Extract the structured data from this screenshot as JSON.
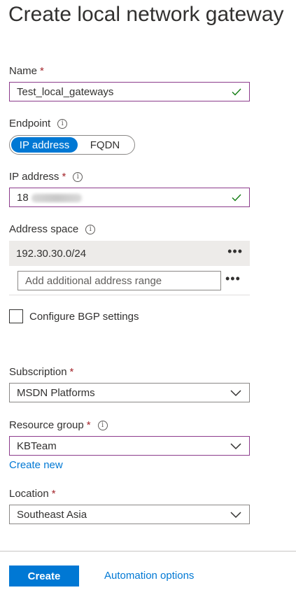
{
  "page": {
    "title": "Create local network gateway"
  },
  "name": {
    "label": "Name",
    "required_mark": "*",
    "value": "Test_local_gateways"
  },
  "endpoint": {
    "label": "Endpoint",
    "options": [
      "IP address",
      "FQDN"
    ],
    "selected": "IP address"
  },
  "ip_address": {
    "label": "IP address",
    "required_mark": "*",
    "value_visible": "18"
  },
  "address_space": {
    "label": "Address space",
    "entries": [
      "192.30.30.0/24"
    ],
    "add_placeholder": "Add additional address range",
    "more_icon": "ellipsis-icon"
  },
  "bgp": {
    "label": "Configure BGP settings",
    "checked": false
  },
  "subscription": {
    "label": "Subscription",
    "required_mark": "*",
    "value": "MSDN Platforms"
  },
  "resource_group": {
    "label": "Resource group",
    "required_mark": "*",
    "value": "KBTeam",
    "create_new": "Create new"
  },
  "location": {
    "label": "Location",
    "required_mark": "*",
    "value": "Southeast Asia"
  },
  "footer": {
    "create_label": "Create",
    "automation_label": "Automation options"
  },
  "info_glyph": "i",
  "colors": {
    "accent": "#0078d4",
    "valid_border": "#8c3b8c",
    "check": "#107c10",
    "required": "#a4262c"
  }
}
